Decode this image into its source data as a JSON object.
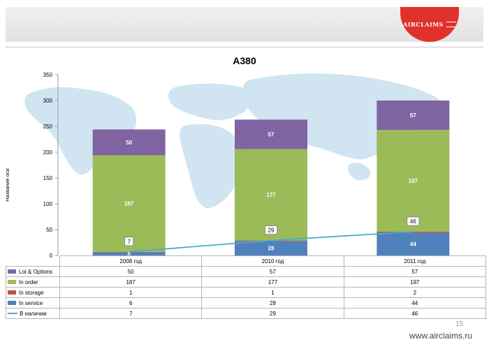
{
  "logo_text": "AIRCLAIMS",
  "colors": {
    "loi": "#8064a2",
    "order": "#9bbb59",
    "storage": "#c0504d",
    "service": "#4f81bd",
    "available": "#4bacc6",
    "map": "#cfe3f1"
  },
  "chart_data": {
    "type": "bar",
    "stacked": true,
    "title": "A380",
    "ylabel": "Название оси",
    "xlabel": "",
    "ylim": [
      0,
      350
    ],
    "yticks": [
      0,
      50,
      100,
      150,
      200,
      250,
      300,
      350
    ],
    "categories": [
      "2008 год",
      "2010 год",
      "2011 год"
    ],
    "series": [
      {
        "name": "Loi & Options",
        "values": [
          50,
          57,
          57
        ]
      },
      {
        "name": "In order",
        "values": [
          187,
          177,
          197
        ]
      },
      {
        "name": "In storage",
        "values": [
          1,
          1,
          2
        ]
      },
      {
        "name": "In service",
        "values": [
          6,
          28,
          44
        ]
      }
    ],
    "line_series": {
      "name": "В наличии",
      "values": [
        7,
        29,
        46
      ]
    },
    "legend": "data-table"
  },
  "footer": {
    "page_number": "15",
    "website": "www.airclaims.ru"
  }
}
